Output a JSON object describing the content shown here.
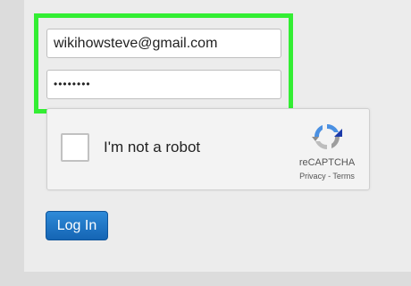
{
  "form": {
    "email_value": "wikihowsteve@gmail.com",
    "password_mask": "••••••••",
    "highlight_color": "#33ee33"
  },
  "captcha": {
    "label": "I'm not a robot",
    "brand": "reCAPTCHA",
    "privacy_link": "Privacy",
    "separator": " - ",
    "terms_link": "Terms",
    "icon": "recaptcha-logo-icon"
  },
  "login": {
    "label": "Log In",
    "color": "#1a74c6"
  }
}
